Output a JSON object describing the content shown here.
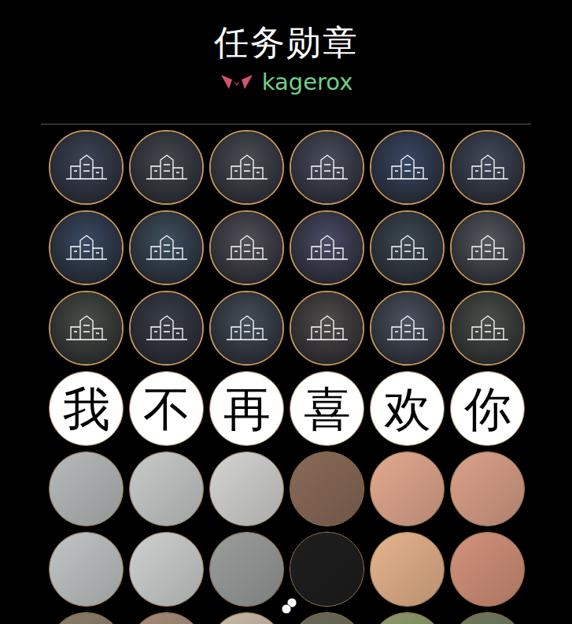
{
  "title": "任务勋章",
  "brand": "kagerox",
  "badges": [
    {
      "kind": "city",
      "color": "#3d4557"
    },
    {
      "kind": "city",
      "color": "#44484f"
    },
    {
      "kind": "city",
      "color": "#4b4e55"
    },
    {
      "kind": "city",
      "color": "#4a4f5e"
    },
    {
      "kind": "city",
      "color": "#3b4866"
    },
    {
      "kind": "city",
      "color": "#424a5a"
    },
    {
      "kind": "city",
      "color": "#3a4a63"
    },
    {
      "kind": "city",
      "color": "#3f5160"
    },
    {
      "kind": "city",
      "color": "#53505a"
    },
    {
      "kind": "city",
      "color": "#4a4d66"
    },
    {
      "kind": "city",
      "color": "#3e4a52"
    },
    {
      "kind": "city",
      "color": "#555a60"
    },
    {
      "kind": "city",
      "color": "#4a4f45"
    },
    {
      "kind": "city",
      "color": "#3a3f4a"
    },
    {
      "kind": "city",
      "color": "#46505a"
    },
    {
      "kind": "city",
      "color": "#524b4a"
    },
    {
      "kind": "city",
      "color": "#4d5561"
    },
    {
      "kind": "city",
      "color": "#4a5148"
    },
    {
      "kind": "character",
      "text": "我",
      "color": "#ffffff"
    },
    {
      "kind": "character",
      "text": "不",
      "color": "#ffffff"
    },
    {
      "kind": "character",
      "text": "再",
      "color": "#ffffff"
    },
    {
      "kind": "character",
      "text": "喜",
      "color": "#ffffff"
    },
    {
      "kind": "character",
      "text": "欢",
      "color": "#ffffff"
    },
    {
      "kind": "character",
      "text": "你",
      "color": "#ffffff"
    },
    {
      "kind": "photo",
      "color": "#b8bbbb"
    },
    {
      "kind": "photo",
      "color": "#c9cbcb"
    },
    {
      "kind": "photo",
      "color": "#d4d5d3"
    },
    {
      "kind": "photo",
      "color": "#8a6a58"
    },
    {
      "kind": "photo",
      "color": "#e3a98f"
    },
    {
      "kind": "photo",
      "color": "#dba189"
    },
    {
      "kind": "photo",
      "color": "#c2c5c5"
    },
    {
      "kind": "photo",
      "color": "#cfd1d1"
    },
    {
      "kind": "photo",
      "color": "#9c9d9d"
    },
    {
      "kind": "photo",
      "color": "#1e1e1e"
    },
    {
      "kind": "photo",
      "color": "#e6b48d"
    },
    {
      "kind": "photo",
      "color": "#d4927a"
    },
    {
      "kind": "photo",
      "color": "#8a7e6a"
    },
    {
      "kind": "photo",
      "color": "#a48b78"
    },
    {
      "kind": "photo",
      "color": "#c7b9a5"
    },
    {
      "kind": "photo",
      "color": "#6b6a5a"
    },
    {
      "kind": "photo",
      "color": "#8b9a6a"
    },
    {
      "kind": "photo",
      "color": "#6f7a5c"
    }
  ]
}
